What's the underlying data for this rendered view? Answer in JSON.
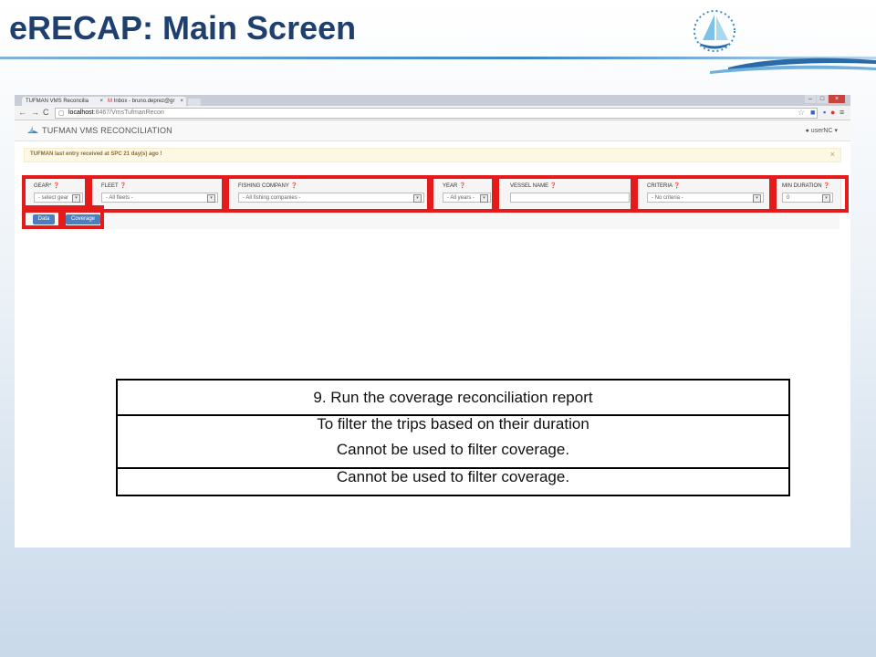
{
  "slide": {
    "title": "eRECAP: Main Screen"
  },
  "browser": {
    "tabs": [
      {
        "label": "TUFMAN VMS Reconcilia"
      },
      {
        "label": "Inbox - bruno.deprez@gr"
      }
    ],
    "url_host": "localhost",
    "url_path": ":8467/VmsTufmanRecon"
  },
  "app": {
    "title": "TUFMAN VMS RECONCILIATION",
    "user": "userNC"
  },
  "alert": {
    "text": "TUFMAN last entry received at SPC 21 day(s) ago !",
    "close": "×"
  },
  "filters": {
    "gear": {
      "label": "GEAR*",
      "value": "- select gear"
    },
    "fleet": {
      "label": "FLEET",
      "value": "- All fleets -"
    },
    "company": {
      "label": "FISHING COMPANY",
      "value": "- All fishing companies -"
    },
    "year": {
      "label": "YEAR",
      "value": "- All years -"
    },
    "vessel": {
      "label": "VESSEL NAME",
      "value": ""
    },
    "criteria": {
      "label": "CRITERIA",
      "value": "- No criteria -"
    },
    "min_duration": {
      "label": "MIN DURATION",
      "value": "0"
    }
  },
  "buttons": {
    "data": "Data",
    "coverage": "Coverage"
  },
  "callout": {
    "row1": "9. Run the coverage reconciliation report",
    "row2": "To filter the trips based on their duration",
    "row3": "Cannot be used to filter coverage.",
    "row4": "Cannot be used to filter coverage."
  },
  "colors": {
    "title": "#1f3f6e",
    "highlight": "#e31b1b",
    "button": "#4a7fc1",
    "alert_bg": "#fcf8e3"
  }
}
